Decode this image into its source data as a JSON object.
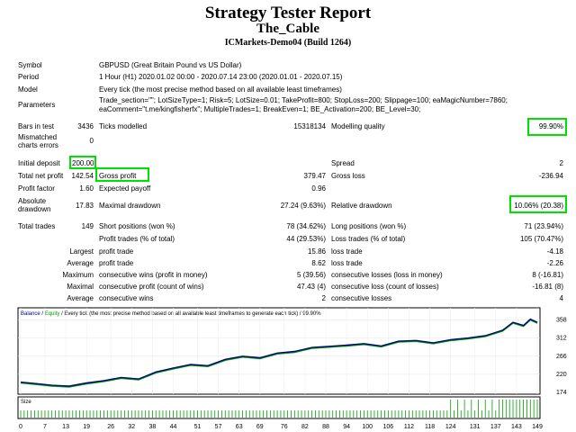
{
  "header": {
    "title": "Strategy Tester Report",
    "ea_name": "The_Cable",
    "server": "ICMarkets-Demo04 (Build 1264)"
  },
  "info": {
    "symbol_label": "Symbol",
    "symbol_value": "GBPUSD (Great Britain Pound vs US Dollar)",
    "period_label": "Period",
    "period_value": "1 Hour (H1) 2020.01.02 00:00 - 2020.07.14 23:00 (2020.01.01 - 2020.07.15)",
    "model_label": "Model",
    "model_value": "Every tick (the most precise method based on all available least timeframes)",
    "params_label": "Parameters",
    "params_line1": "Trade_section=\"\"; LotSizeType=1; Risk=5; LotSize=0.01; TakeProfit=800; StopLoss=200; Slippage=100; eaMagicNumber=7860;",
    "params_line2": "eaComment=\"t.me/kingfisherfx\"; MultipleTrades=1; BreakEven=1; BE_Activation=200; BE_Level=30;"
  },
  "stats": {
    "bars_label": "Bars in test",
    "bars_value": "3436",
    "ticks_label": "Ticks modelled",
    "ticks_value": "15318134",
    "mq_label": "Modelling quality",
    "mq_value": "99.90%",
    "mce_label1": "Mismatched",
    "mce_label2": "charts errors",
    "mce_value": "0",
    "deposit_label": "Initial deposit",
    "deposit_value": "200.00",
    "spread_label": "Spread",
    "spread_value": "2",
    "tnp_label": "Total net profit",
    "tnp_value": "142.54",
    "gp_label": "Gross profit",
    "gp_value": "379.47",
    "gl_label": "Gross loss",
    "gl_value": "-236.94",
    "pf_label": "Profit factor",
    "pf_value": "1.60",
    "ep_label": "Expected payoff",
    "ep_value": "0.96",
    "ad_label1": "Absolute",
    "ad_label2": "drawdown",
    "ad_value": "17.83",
    "md_label": "Maximal drawdown",
    "md_value": "27.24 (9.63%)",
    "rd_label": "Relative drawdown",
    "rd_value": "10.06% (20.38)",
    "tt_label": "Total trades",
    "tt_value": "149",
    "sp_label": "Short positions (won %)",
    "sp_value": "78 (34.62%)",
    "lp_label": "Long positions (won %)",
    "lp_value": "71 (23.94%)",
    "pt_label": "Profit trades (% of total)",
    "pt_value": "44 (29.53%)",
    "lt_label": "Loss trades (% of total)",
    "lt_value": "105 (70.47%)",
    "largest": "Largest",
    "average": "Average",
    "maximum": "Maximum",
    "maximal": "Maximal",
    "profit_trade": "profit trade",
    "loss_trade": "loss trade",
    "lpt_value": "15.86",
    "llt_value": "-4.18",
    "apt_value": "8.62",
    "alt_value": "-2.26",
    "cw_money_label": "consecutive wins (profit in money)",
    "cw_money_value": "5 (39.56)",
    "cl_money_label": "consecutive losses (loss in money)",
    "cl_money_value": "8 (-16.81)",
    "cp_count_label": "consecutive profit (count of wins)",
    "cp_count_value": "47.43 (4)",
    "cl_count_label": "consecutive loss (count of losses)",
    "cl_count_value": "-16.81 (8)",
    "acw_label": "consecutive wins",
    "acw_value": "2",
    "acl_label": "consecutive losses",
    "acl_value": "4"
  },
  "chart": {
    "legend_balance": "Balance",
    "legend_sep": "/",
    "legend_equity": "Equity",
    "legend_rest": "/ Every tick (the most precise method based on all available least timeframes to generate each tick) / 99.90%",
    "size_label": "Size",
    "balance_color": "#000080",
    "equity_color": "#00a000",
    "volume_color": "#00a000"
  },
  "chart_data": {
    "type": "line",
    "series": [
      {
        "name": "Balance",
        "x": [
          0,
          5,
          9,
          14,
          19,
          24,
          29,
          34,
          39,
          44,
          49,
          54,
          59,
          64,
          69,
          74,
          79,
          84,
          89,
          94,
          99,
          104,
          109,
          114,
          119,
          124,
          129,
          134,
          139,
          142,
          145,
          147,
          149
        ],
        "values": [
          200,
          196,
          192,
          190,
          198,
          204,
          212,
          208,
          226,
          236,
          245,
          242,
          258,
          266,
          262,
          274,
          278,
          288,
          291,
          294,
          298,
          292,
          304,
          306,
          300,
          308,
          312,
          318,
          332,
          352,
          344,
          360,
          352
        ]
      }
    ],
    "y_ticks": [
      174,
      220,
      266,
      312,
      358
    ],
    "x_ticks": [
      0,
      7,
      13,
      19,
      26,
      32,
      38,
      44,
      51,
      57,
      63,
      69,
      76,
      82,
      88,
      94,
      100,
      106,
      112,
      118,
      124,
      131,
      137,
      143,
      149
    ],
    "ylim": [
      174,
      366
    ],
    "xlim": [
      0,
      149
    ]
  }
}
